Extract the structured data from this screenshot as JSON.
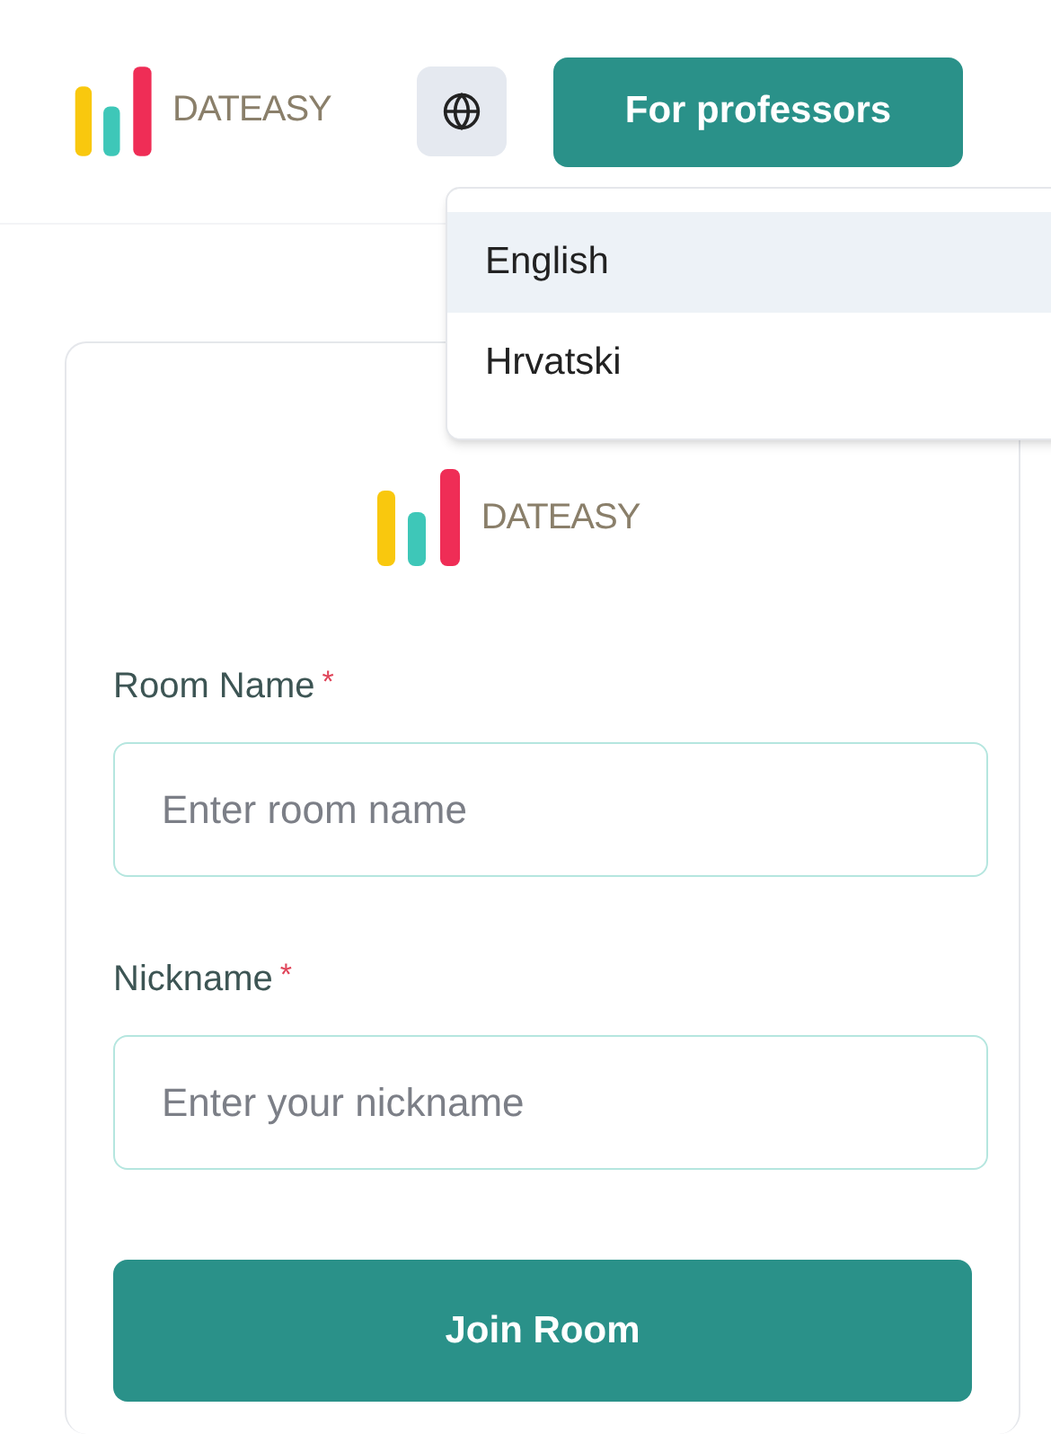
{
  "header": {
    "logo": {
      "text": "DATEASY"
    },
    "button": "For professors"
  },
  "language_menu": {
    "items": [
      {
        "label": "English",
        "selected": true
      },
      {
        "label": "Hrvatski",
        "selected": false
      }
    ]
  },
  "card": {
    "logo": {
      "text": "DATEASY"
    },
    "fields": [
      {
        "label": "Room Name",
        "required_mark": "*",
        "placeholder": "Enter room name"
      },
      {
        "label": "Nickname",
        "required_mark": "*",
        "placeholder": "Enter your nickname"
      }
    ],
    "submit": "Join Room"
  }
}
